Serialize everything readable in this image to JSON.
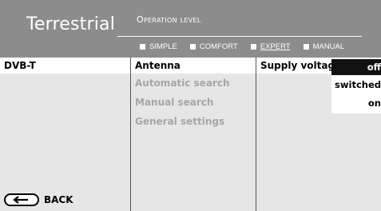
{
  "header": {
    "title": "Terrestrial",
    "operation_level": "Operation level",
    "modes": [
      {
        "label": "SIMPLE",
        "active": false
      },
      {
        "label": "COMFORT",
        "active": false
      },
      {
        "label": "EXPERT",
        "active": true
      },
      {
        "label": "MANUAL",
        "active": false
      }
    ]
  },
  "columns": {
    "col1": {
      "items": [
        {
          "label": "DVB-T",
          "enabled": true,
          "selected": true
        }
      ]
    },
    "col2": {
      "items": [
        {
          "label": "Antenna",
          "enabled": true,
          "selected": true
        },
        {
          "label": "Automatic search",
          "enabled": false
        },
        {
          "label": "Manual search",
          "enabled": false
        },
        {
          "label": "General settings",
          "enabled": false
        }
      ]
    },
    "col3": {
      "items": [
        {
          "label": "Supply voltage",
          "enabled": true,
          "selected": true
        }
      ]
    }
  },
  "dropdown": {
    "options": [
      {
        "label": "off",
        "selected": true
      },
      {
        "label": "switched",
        "selected": false
      },
      {
        "label": "on",
        "selected": false
      }
    ]
  },
  "footer": {
    "back_label": "BACK"
  }
}
